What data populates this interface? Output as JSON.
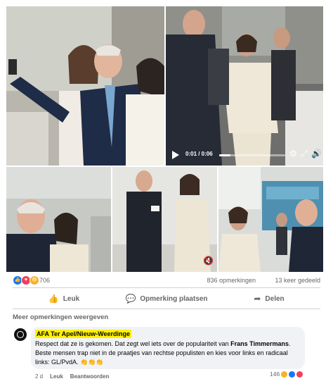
{
  "video": {
    "time": "0:01 / 0:06",
    "progress_fraction": 0.17
  },
  "stats": {
    "reaction_count": "706",
    "comments": "836 opmerkingen",
    "shares": "13 keer gedeeld"
  },
  "actions": {
    "like": "Leuk",
    "comment": "Opmerking plaatsen",
    "share": "Delen"
  },
  "comments_section": {
    "more_link": "Meer opmerkingen weergeven",
    "comment": {
      "author": "AFA Ter Apel/Nieuw-Weerdinge",
      "text_part1": "Respect dat ze is gekomen. Dat zegt wel iets over de populariteit van ",
      "text_bold": "Frans Timmermans",
      "text_part2": ". Beste mensen trap niet in de praatjes van rechtse populisten en kies voor links en radicaal links: GL/PvdA. 👏👏👏",
      "reaction_count": "146",
      "time": "2 d",
      "like": "Leuk",
      "reply": "Beantwoorden"
    }
  },
  "colors": {
    "like_blue": "#1877f2",
    "love_red": "#f33e58",
    "haha_yellow": "#f7b125",
    "highlight": "#fff200",
    "muted": "#65676b"
  },
  "icons": [
    "play-icon",
    "settings-icon",
    "fullscreen-icon",
    "volume-icon",
    "like-icon",
    "comment-icon",
    "share-icon"
  ]
}
